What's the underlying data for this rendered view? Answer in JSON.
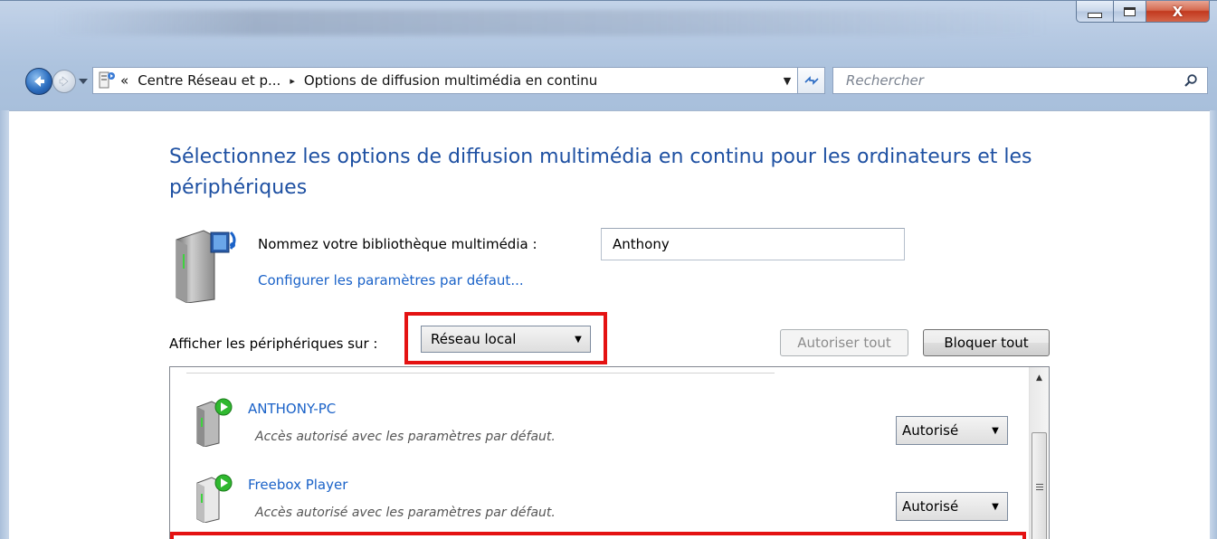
{
  "window": {
    "caption_buttons": {
      "minimize": "minimize-icon",
      "maximize": "maximize-icon",
      "close_label": "X"
    }
  },
  "nav": {
    "back_icon": "back-arrow-icon",
    "forward_icon": "forward-arrow-icon",
    "address": {
      "overflow": "«",
      "breadcrumbs": [
        "Centre Réseau et p...",
        "Options de diffusion multimédia en continu"
      ],
      "separator": "▸"
    },
    "search": {
      "placeholder": "Rechercher"
    }
  },
  "content": {
    "title": "Sélectionnez les options de diffusion multimédia en continu pour les ordinateurs et les périphériques",
    "library": {
      "label": "Nommez votre bibliothèque multimédia :",
      "value": "Anthony",
      "configure_link": "Configurer les paramètres par défaut..."
    },
    "filter": {
      "label": "Afficher les périphériques sur :",
      "selected": "Réseau local"
    },
    "buttons": {
      "allow_all": "Autoriser tout",
      "block_all": "Bloquer tout"
    },
    "devices": [
      {
        "name": "ANTHONY-PC",
        "description": "Accès autorisé avec les paramètres par défaut.",
        "status": "Autorisé"
      },
      {
        "name": "Freebox Player",
        "description": "Accès autorisé avec les paramètres par défaut.",
        "status": "Autorisé"
      }
    ]
  },
  "colors": {
    "highlight": "#e41212",
    "link": "#1a62c8",
    "title": "#1e50a2"
  }
}
